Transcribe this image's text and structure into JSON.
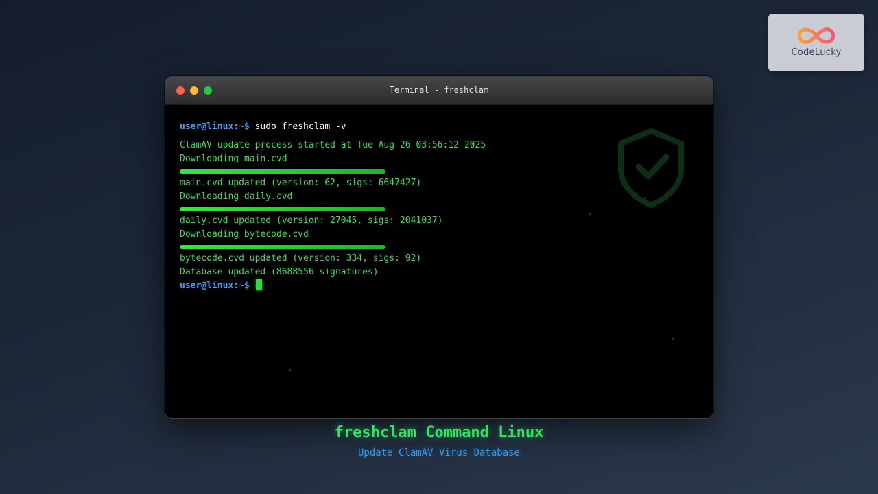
{
  "logo": {
    "text": "CodeLucky",
    "icon": "infinity-icon",
    "colors": [
      "#f7a13b",
      "#ef5a78"
    ]
  },
  "window": {
    "title": "Terminal - freshclam",
    "controls": [
      "close-dot",
      "minimize-dot",
      "maximize-dot"
    ]
  },
  "terminal": {
    "prompt": "user@linux:~$",
    "command": " sudo freshclam -v",
    "lines": [
      "ClamAV update process started at Tue Aug 26 03:56:12 2025",
      "Downloading main.cvd",
      "main.cvd updated (version: 62, sigs: 6647427)",
      "Downloading daily.cvd",
      "daily.cvd updated (version: 27045, sigs: 2041037)",
      "Downloading bytecode.cvd",
      "bytecode.cvd updated (version: 334, sigs: 92)",
      "Database updated (8688556 signatures)"
    ],
    "progress": [
      {
        "file": "main.cvd",
        "percent": 100
      },
      {
        "file": "daily.cvd",
        "percent": 100
      },
      {
        "file": "bytecode.cvd",
        "percent": 100
      }
    ],
    "final_prompt": "user@linux:~$",
    "watermark_icon": "shield-check-icon"
  },
  "caption": {
    "title": "freshclam Command Linux",
    "subtitle": "Update ClamAV Virus Database"
  },
  "colors": {
    "prompt": "#3ea3ff",
    "output": "#3ddc5a",
    "progress": "#36e63f",
    "caption_title": "#2ee864",
    "caption_subtitle": "#2a9cf0"
  }
}
